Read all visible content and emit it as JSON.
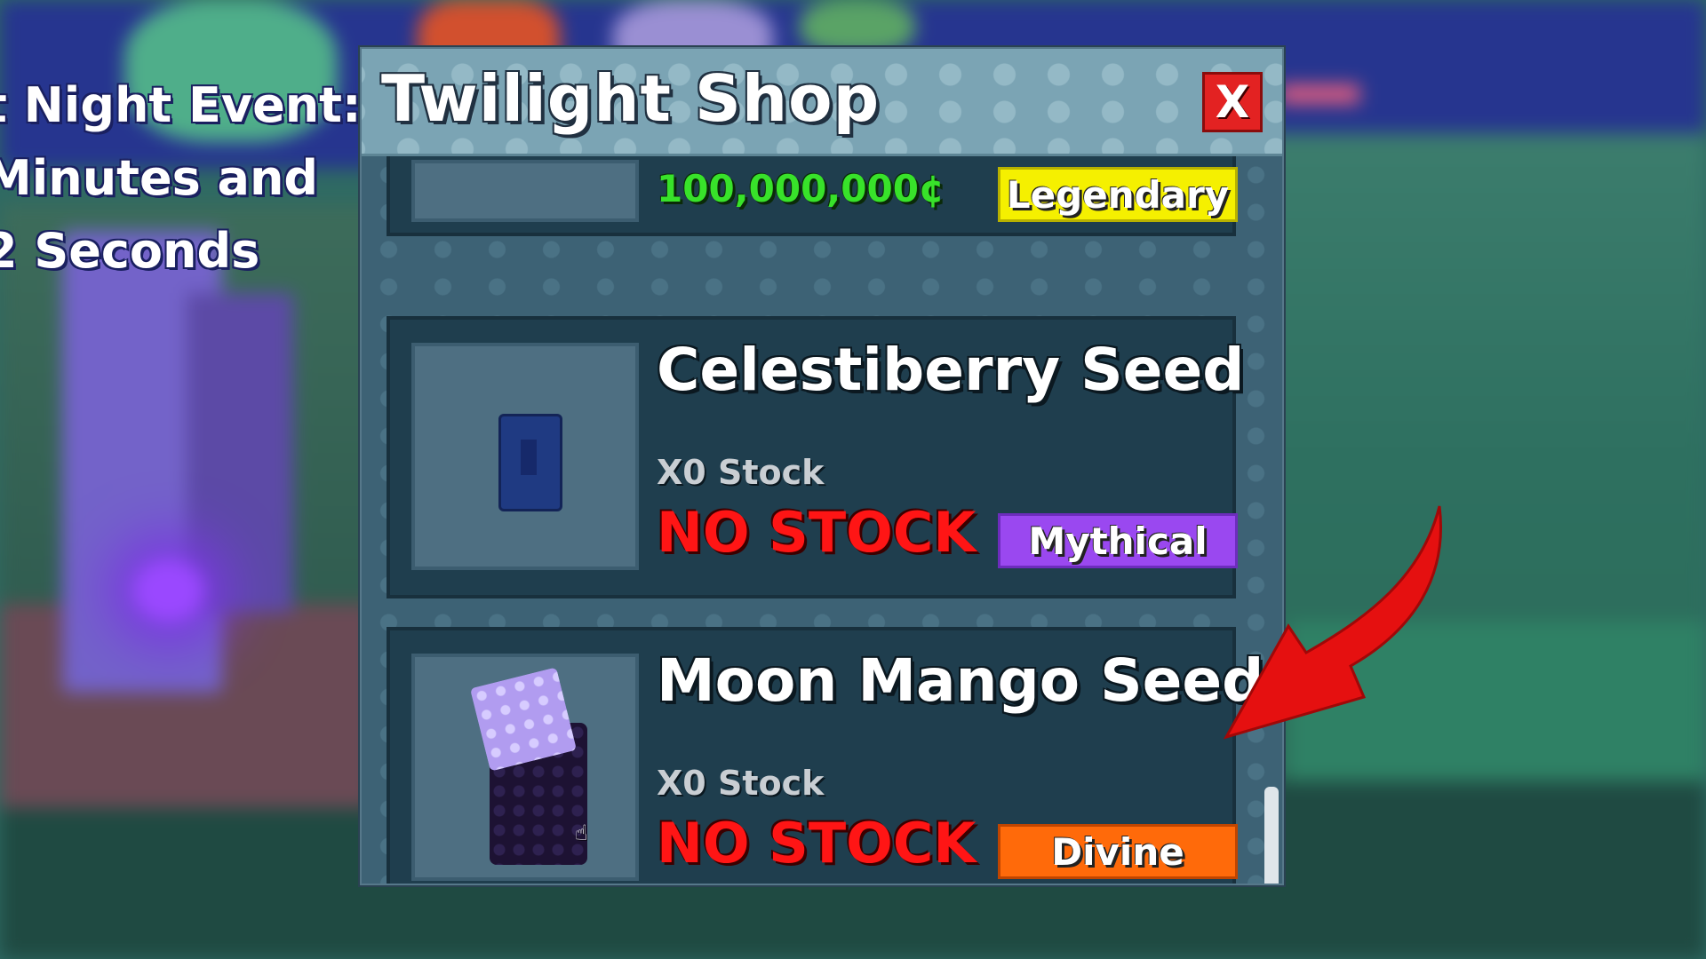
{
  "event": {
    "line1": "t Night Event:",
    "line2": "Minutes and",
    "line3": "2 Seconds"
  },
  "shop": {
    "title": "Twilight Shop",
    "close_label": "X",
    "items": [
      {
        "name": "",
        "price": "100,000,000¢",
        "rarity": "Legendary",
        "rarity_color": "#f5f000"
      },
      {
        "name": "Celestiberry Seed",
        "stock": "X0 Stock",
        "status": "NO STOCK",
        "rarity": "Mythical",
        "rarity_color": "#9a48f0"
      },
      {
        "name": "Moon Mango Seed",
        "stock": "X0 Stock",
        "status": "NO STOCK",
        "rarity": "Divine",
        "rarity_color": "#ff6a0a"
      }
    ]
  },
  "colors": {
    "title_bar": "#7ba4b4",
    "close_button": "#e32222",
    "no_stock": "#ff1515",
    "price": "#38e22a",
    "arrow": "#e51010"
  },
  "icons": {
    "item1": "celestiberry-seed-icon",
    "item2": "moon-mango-seed-icon",
    "arrow": "red-arrow-icon"
  }
}
